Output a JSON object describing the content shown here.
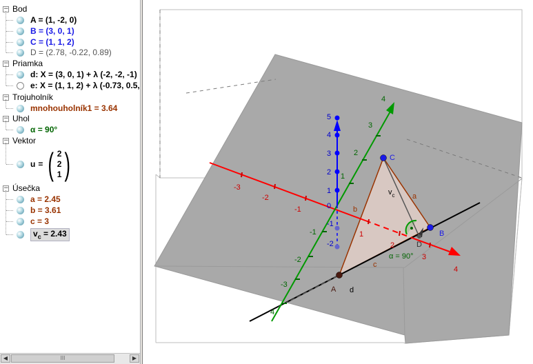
{
  "algebra": {
    "groups": [
      {
        "title": "Bod",
        "items": [
          {
            "label": "A = (1, -2, 0)",
            "color": "#000000",
            "visible": true
          },
          {
            "label": "B = (3, 0, 1)",
            "color": "#1a1ae6",
            "visible": true
          },
          {
            "label": "C = (1, 1, 2)",
            "color": "#1a1ae6",
            "visible": true
          },
          {
            "label": "D = (2.78, -0.22, 0.89)",
            "color": "#555555",
            "visible": true
          }
        ]
      },
      {
        "title": "Priamka",
        "items": [
          {
            "label": "d: X = (3, 0, 1) + λ (-2, -2, -1)",
            "color": "#000000",
            "visible": true
          },
          {
            "label": "e: X = (1, 1, 2) + λ (-0.73, 0.5,",
            "color": "#000000",
            "visible": false
          }
        ]
      },
      {
        "title": "Trojuholník",
        "items": [
          {
            "label": "mnohouholník1 = 3.64",
            "color": "#993300",
            "visible": true
          }
        ]
      },
      {
        "title": "Uhol",
        "items": [
          {
            "label": "α = 90°",
            "color": "#006400",
            "visible": true
          }
        ]
      },
      {
        "title": "Vektor",
        "vector": {
          "name": "u",
          "eq": "=",
          "values": [
            "2",
            "2",
            "1"
          ]
        }
      },
      {
        "title": "Úsečka",
        "items": [
          {
            "label": "a = 2.45",
            "color": "#993300",
            "visible": true
          },
          {
            "label": "b = 3.61",
            "color": "#993300",
            "visible": true
          },
          {
            "label": "c = 3",
            "color": "#993300",
            "visible": true
          },
          {
            "label": "v",
            "sub": "c",
            "rest": " = 2.43",
            "color": "#000000",
            "visible": true,
            "selected": true
          }
        ]
      }
    ]
  },
  "scrollbar": {
    "left": "◀",
    "right": "▶",
    "grip": "III"
  },
  "graphics": {
    "x_ticks": [
      "-3",
      "-2",
      "-1",
      "1",
      "2",
      "3",
      "4"
    ],
    "y_ticks": [
      "-3",
      "-2",
      "-1",
      "1",
      "2",
      "3",
      "4"
    ],
    "z_ticks": [
      "-2",
      "-1",
      "0",
      "1",
      "2",
      "3",
      "4",
      "5"
    ],
    "y_end": "4",
    "y_neg_end": "4",
    "points": [
      "A",
      "B",
      "C",
      "D"
    ],
    "segments": [
      "a",
      "b",
      "c"
    ],
    "height_label": "v",
    "height_sub": "c",
    "line_label": "d",
    "angle_label": "α = 90°",
    "colors": {
      "x_axis": "#ff0000",
      "y_axis": "#009900",
      "z_axis": "#0000ff",
      "triangle": "#993300",
      "plane": "#a9a9a9"
    }
  }
}
